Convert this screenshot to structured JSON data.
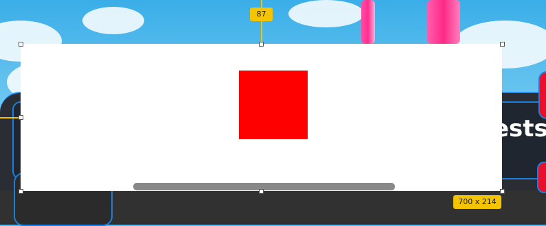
{
  "measure": {
    "distance_label": "87",
    "size_label": "700 x 214"
  },
  "background_panel": {
    "partial_text": "ests"
  },
  "colors": {
    "selection_guide": "#f5c400",
    "square": "#ff0000",
    "canvas": "#ffffff",
    "scrollbar": "#888888",
    "panel_border": "#1b7fe0",
    "panel_bg": "#2a2d33"
  }
}
